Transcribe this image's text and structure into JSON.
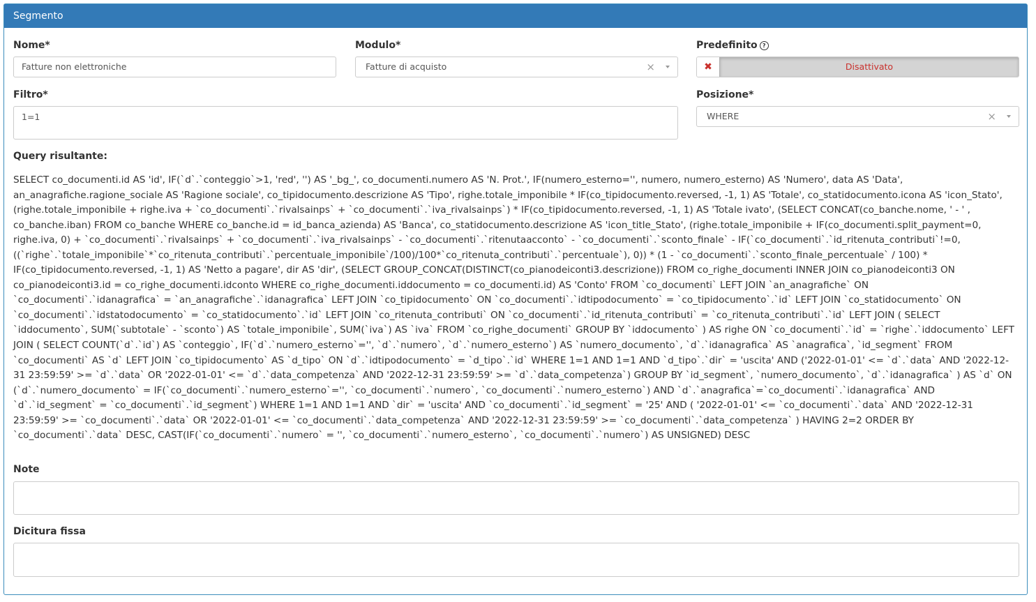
{
  "panel": {
    "title": "Segmento"
  },
  "fields": {
    "nome": {
      "label": "Nome*",
      "value": "Fatture non elettroniche"
    },
    "modulo": {
      "label": "Modulo*",
      "value": "Fatture di acquisto",
      "clear": "×"
    },
    "predefinito": {
      "label": "Predefinito",
      "help_icon": "?",
      "state_icon": "✖",
      "state": "Disattivato"
    },
    "filtro": {
      "label": "Filtro*",
      "value": "1=1"
    },
    "posizione": {
      "label": "Posizione*",
      "value": "WHERE",
      "clear": "×"
    },
    "query": {
      "label": "Query risultante:",
      "text": "SELECT co_documenti.id AS 'id', IF(`d`.`conteggio`>1, 'red', '') AS '_bg_', co_documenti.numero AS 'N. Prot.', IF(numero_esterno='', numero, numero_esterno) AS 'Numero', data AS 'Data', an_anagrafiche.ragione_sociale AS 'Ragione sociale', co_tipidocumento.descrizione AS 'Tipo', righe.totale_imponibile * IF(co_tipidocumento.reversed, -1, 1) AS 'Totale', co_statidocumento.icona AS 'icon_Stato', (righe.totale_imponibile + righe.iva + `co_documenti`.`rivalsainps` + `co_documenti`.`iva_rivalsainps`) * IF(co_tipidocumento.reversed, -1, 1) AS 'Totale ivato', (SELECT CONCAT(co_banche.nome, ' - ' , co_banche.iban) FROM co_banche WHERE co_banche.id = id_banca_azienda) AS 'Banca', co_statidocumento.descrizione AS 'icon_title_Stato', (righe.totale_imponibile + IF(co_documenti.split_payment=0, righe.iva, 0) + `co_documenti`.`rivalsainps` + `co_documenti`.`iva_rivalsainps` - `co_documenti`.`ritenutaacconto` - `co_documenti`.`sconto_finale` - IF(`co_documenti`.`id_ritenuta_contributi`!=0, ((`righe`.`totale_imponibile`*`co_ritenuta_contributi`.`percentuale_imponibile`/100)/100*`co_ritenuta_contributi`.`percentuale`), 0)) * (1 - `co_documenti`.`sconto_finale_percentuale` / 100) * IF(co_tipidocumento.reversed, -1, 1) AS 'Netto a pagare', dir AS 'dir', (SELECT GROUP_CONCAT(DISTINCT(co_pianodeiconti3.descrizione)) FROM co_righe_documenti INNER JOIN co_pianodeiconti3 ON co_pianodeiconti3.id = co_righe_documenti.idconto WHERE co_righe_documenti.iddocumento = co_documenti.id) AS 'Conto' FROM `co_documenti` LEFT JOIN `an_anagrafiche` ON `co_documenti`.`idanagrafica` = `an_anagrafiche`.`idanagrafica` LEFT JOIN `co_tipidocumento` ON `co_documenti`.`idtipodocumento` = `co_tipidocumento`.`id` LEFT JOIN `co_statidocumento` ON `co_documenti`.`idstatodocumento` = `co_statidocumento`.`id` LEFT JOIN `co_ritenuta_contributi` ON `co_documenti`.`id_ritenuta_contributi` = `co_ritenuta_contributi`.`id` LEFT JOIN ( SELECT `iddocumento`, SUM(`subtotale` - `sconto`) AS `totale_imponibile`, SUM(`iva`) AS `iva` FROM `co_righe_documenti` GROUP BY `iddocumento` ) AS righe ON `co_documenti`.`id` = `righe`.`iddocumento` LEFT JOIN ( SELECT COUNT(`d`.`id`) AS `conteggio`, IF(`d`.`numero_esterno`='', `d`.`numero`, `d`.`numero_esterno`) AS `numero_documento`, `d`.`idanagrafica` AS `anagrafica`, `id_segment` FROM `co_documenti` AS `d` LEFT JOIN `co_tipidocumento` AS `d_tipo` ON `d`.`idtipodocumento` = `d_tipo`.`id` WHERE 1=1 AND 1=1 AND `d_tipo`.`dir` = 'uscita' AND ('2022-01-01' <= `d`.`data` AND '2022-12-31 23:59:59' >= `d`.`data` OR '2022-01-01' <= `d`.`data_competenza` AND '2022-12-31 23:59:59' >= `d`.`data_competenza`) GROUP BY `id_segment`, `numero_documento`, `d`.`idanagrafica` ) AS `d` ON (`d`.`numero_documento` = IF(`co_documenti`.`numero_esterno`='', `co_documenti`.`numero`, `co_documenti`.`numero_esterno`) AND `d`.`anagrafica`=`co_documenti`.`idanagrafica` AND `d`.`id_segment` = `co_documenti`.`id_segment`) WHERE 1=1 AND 1=1 AND `dir` = 'uscita' AND `co_documenti`.`id_segment` = '25' AND ( '2022-01-01' <= `co_documenti`.`data` AND '2022-12-31 23:59:59' >= `co_documenti`.`data` OR '2022-01-01' <= `co_documenti`.`data_competenza` AND '2022-12-31 23:59:59' >= `co_documenti`.`data_competenza` ) HAVING 2=2 ORDER BY `co_documenti`.`data` DESC, CAST(IF(`co_documenti`.`numero` = '', `co_documenti`.`numero_esterno`, `co_documenti`.`numero`) AS UNSIGNED) DESC"
    },
    "note": {
      "label": "Note",
      "value": ""
    },
    "dicitura": {
      "label": "Dicitura fissa",
      "value": ""
    }
  },
  "colors": {
    "header_bg": "#337ab7",
    "danger": "#c9302c"
  }
}
